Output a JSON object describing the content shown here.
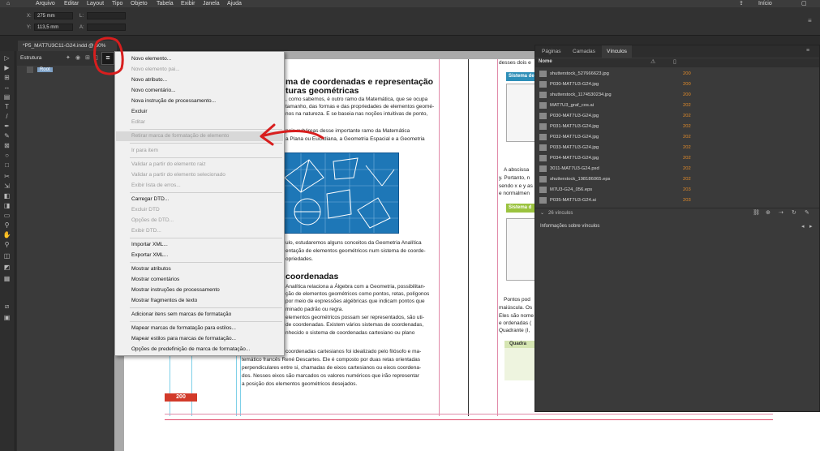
{
  "menubar": {
    "items": [
      "Arquivo",
      "Editar",
      "Layout",
      "Tipo",
      "Objeto",
      "Tabela",
      "Exibir",
      "Janela",
      "Ajuda"
    ],
    "right_label": "Início"
  },
  "control": {
    "x_label": "X:",
    "x_value": "275 mm",
    "y_label": "Y:",
    "y_value": "113,5 mm",
    "l_label": "L:",
    "a_label": "A:"
  },
  "document": {
    "tab_title": "*P5_MAT7U3C11-G24.indd @ 60%",
    "page_number": "200",
    "body_lines": [
      "ma de coordenadas e representação",
      "turas geométricas",
      ", como sabemos, é outro ramo da Matemática, que se ocupa",
      "tamanho, das formas e das propriedades de elementos geomé-",
      "nos na natureza. E se baseia nas noções intuitivas de ponto,",
      "pais subáreas desse importante ramo da Matemática",
      "a Plana ou Euclidiana, a Geometria Espacial e a Geometria",
      "ulo, estudaremos alguns conceitos da Geometria Analítica",
      "entação de elementos geométricos num sistema de coorde-",
      "opriedades.",
      "coordenadas",
      "Analítica relaciona a Álgebra com a Geometria, possibilitan-",
      "ção de elementos geométricos como pontos, retas, polígonos",
      "por meio de expressões algébricas que indicam pontos que",
      "minado padrão ou regra.",
      "elementos geométricos possam ser representados, são uti-",
      "de coordenadas. Existem vários sistemas de coordenadas,",
      "nhecido o sistema de coordenadas cartesiano ou plano",
      "coordenadas cartesianos foi idealizado pelo filósofo e ma-",
      "temático francês René Descartes. Ele é composto por duas retas orientadas",
      "perpendiculares entre si, chamadas de eixos cartesianos ou eixos coordena-",
      "dos. Nesses eixos são marcados os valores numéricos que irão representar",
      "a posição dos elementos geométricos desejados."
    ],
    "right_page_lines": [
      "desses dois e",
      "Sistema de",
      "A abscissa",
      "y. Portanto, n",
      "sendo x e y as",
      "e normalmen",
      "Sistema d",
      "Pontos pod",
      "maiúscula. Os",
      "Eles são nome",
      "e ordenadas (",
      "Quadrante (I,",
      "Quadra"
    ]
  },
  "structure_panel": {
    "title": "Estrutura",
    "root_label": "Root"
  },
  "context_menu": {
    "items": [
      {
        "label": "Novo elemento...",
        "enabled": true
      },
      {
        "label": "Novo elemento pai...",
        "enabled": false
      },
      {
        "label": "Novo atributo...",
        "enabled": true
      },
      {
        "label": "Novo comentário...",
        "enabled": true
      },
      {
        "label": "Nova instrução de processamento...",
        "enabled": true
      },
      {
        "label": "Excluir",
        "enabled": true
      },
      {
        "label": "Editar",
        "enabled": false
      },
      {
        "label": "Retirar marca de formatação de elemento",
        "enabled": false
      },
      {
        "label": "Ir para item",
        "enabled": false
      },
      {
        "label": "Validar a partir do elemento raiz",
        "enabled": false
      },
      {
        "label": "Validar a partir do elemento selecionado",
        "enabled": false
      },
      {
        "label": "Exibir lista de erros...",
        "enabled": false
      },
      {
        "label": "Carregar DTD...",
        "enabled": true
      },
      {
        "label": "Excluir DTD",
        "enabled": false
      },
      {
        "label": "Opções de DTD...",
        "enabled": false
      },
      {
        "label": "Exibir DTD...",
        "enabled": false
      },
      {
        "label": "Importar XML...",
        "enabled": true
      },
      {
        "label": "Exportar XML...",
        "enabled": true
      },
      {
        "label": "Mostrar atributos",
        "enabled": true
      },
      {
        "label": "Mostrar comentários",
        "enabled": true
      },
      {
        "label": "Mostrar instruções de processamento",
        "enabled": true
      },
      {
        "label": "Mostrar fragmentos de texto",
        "enabled": true
      },
      {
        "label": "Adicionar itens sem marcas de formatação",
        "enabled": true
      },
      {
        "label": "Mapear marcas de formatação para estilos...",
        "enabled": true
      },
      {
        "label": "Mapear estilos para marcas de formatação...",
        "enabled": true
      },
      {
        "label": "Opções de predefinição de marca de formatação...",
        "enabled": true
      }
    ]
  },
  "links_panel": {
    "tabs": [
      "Páginas",
      "Camadas",
      "Vínculos"
    ],
    "column_name": "Nome",
    "links": [
      {
        "name": "shutterstock_527666623.jpg",
        "page": "200"
      },
      {
        "name": "P030-MAT7U3-G24.jpg",
        "page": "200"
      },
      {
        "name": "shutterstock_1174530234.jpg",
        "page": "200"
      },
      {
        "name": "MAT7U3_graf_cos.ai",
        "page": "202"
      },
      {
        "name": "P030-MAT7U3-G24.jpg",
        "page": "202"
      },
      {
        "name": "P031-MAT7U3-G24.jpg",
        "page": "202"
      },
      {
        "name": "P032-MAT7U3-G24.jpg",
        "page": "202"
      },
      {
        "name": "P033-MAT7U3-G24.jpg",
        "page": "202"
      },
      {
        "name": "P034-MAT7U3-G24.jpg",
        "page": "202"
      },
      {
        "name": "3011-MAT7U3-G24.psd",
        "page": "202"
      },
      {
        "name": "shutterstock_198186065.eps",
        "page": "202"
      },
      {
        "name": "M7U3-G24_056.eps",
        "page": "203"
      },
      {
        "name": "P035-MAT7U3-G24.ai",
        "page": "203"
      }
    ],
    "count_label": "26 vínculos",
    "info_label": "Informações sobre vínculos"
  },
  "colors": {
    "accent_blue": "#1e77b7",
    "heading_teal": "#2e8fb8",
    "highlight_green": "#9bc33f",
    "page_badge_red": "#d23a2a",
    "annotation_red": "#d81e1e",
    "links_page_orange": "#e08a2a"
  }
}
